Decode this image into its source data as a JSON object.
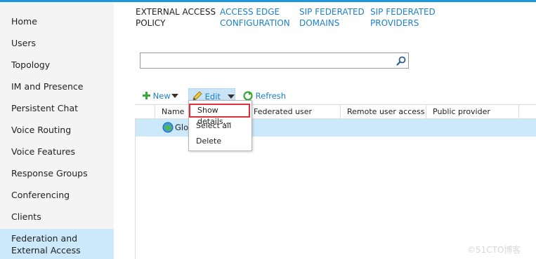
{
  "sidebar": {
    "items": [
      {
        "label": "Home"
      },
      {
        "label": "Users"
      },
      {
        "label": "Topology"
      },
      {
        "label": "IM and Presence"
      },
      {
        "label": "Persistent Chat"
      },
      {
        "label": "Voice Routing"
      },
      {
        "label": "Voice Features"
      },
      {
        "label": "Response Groups"
      },
      {
        "label": "Conferencing"
      },
      {
        "label": "Clients"
      },
      {
        "label_line1": "Federation and",
        "label_line2": "External Access",
        "selected": true
      }
    ]
  },
  "tabs": [
    {
      "line1": "EXTERNAL ACCESS",
      "line2": "POLICY",
      "active": true
    },
    {
      "line1": "ACCESS EDGE",
      "line2": "CONFIGURATION"
    },
    {
      "line1": "SIP FEDERATED",
      "line2": "DOMAINS"
    },
    {
      "line1": "SIP FEDERATED",
      "line2": "PROVIDERS"
    }
  ],
  "search": {
    "value": "",
    "placeholder": ""
  },
  "toolbar": {
    "new_label": "New",
    "edit_label": "Edit",
    "refresh_label": "Refresh"
  },
  "grid": {
    "columns": [
      "Name",
      "Federated user access",
      "Remote user access",
      "Public provider access"
    ],
    "rows": [
      {
        "name": "Glob"
      }
    ]
  },
  "edit_menu": {
    "items": [
      "Show details...",
      "Select all",
      "Delete"
    ],
    "highlighted": "Show details..."
  },
  "watermark": "©51CTO博客",
  "colors": {
    "accent": "#1c80c8",
    "selection": "#cce8fb",
    "highlight_border": "#e0303a"
  }
}
